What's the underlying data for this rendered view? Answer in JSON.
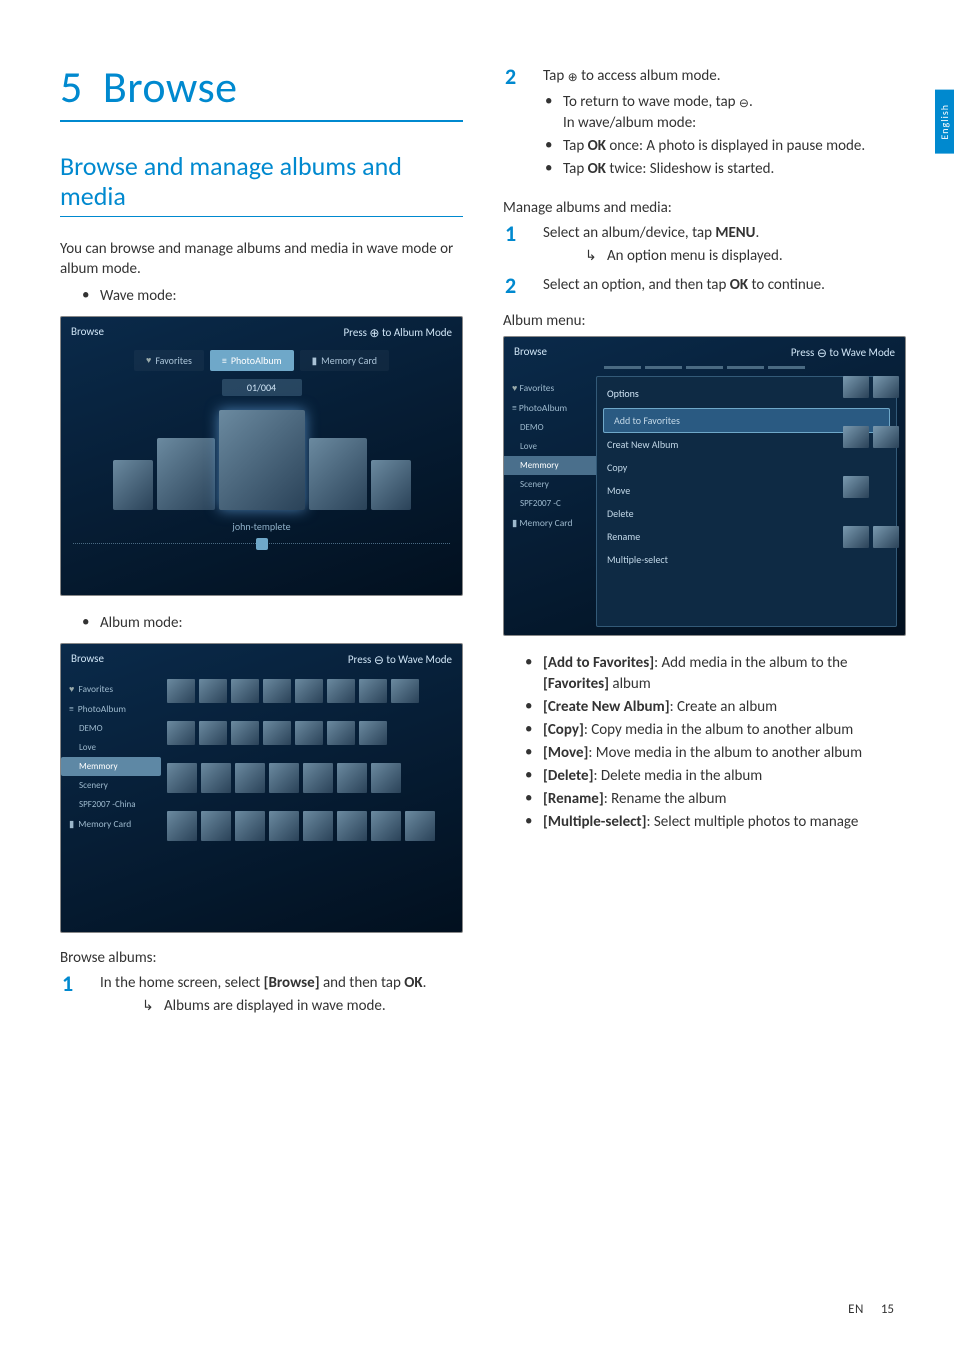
{
  "lang_tab": "English",
  "chapter": {
    "number": "5",
    "title": "Browse"
  },
  "section_title": "Browse and manage albums and media",
  "intro": "You can browse and manage albums and media in wave mode or album mode.",
  "modes": {
    "wave": "Wave mode:",
    "album": "Album mode:"
  },
  "wave_ss": {
    "title": "Browse",
    "hint_prefix": "Press ",
    "hint_suffix": " to Album Mode",
    "tabs": {
      "fav": "Favorites",
      "photo": "PhotoAlbum",
      "card": "Memory Card"
    },
    "counter": "01/004",
    "caption": "john-templete"
  },
  "album_ss": {
    "title": "Browse",
    "hint_prefix": "Press ",
    "hint_suffix": " to Wave Mode",
    "sidebar": {
      "fav": "Favorites",
      "photo": "PhotoAlbum",
      "demo": "DEMO",
      "love": "Love",
      "mem": "Memmory",
      "scenery": "Scenery",
      "spf": "SPF2007 -China",
      "card": "Memory Card"
    }
  },
  "browse_head": "Browse albums:",
  "step1": {
    "a": "In the home screen, select ",
    "b": "[Browse]",
    "c": " and then tap ",
    "d": "OK",
    "e": "."
  },
  "step1_res": "Albums are displayed in wave mode.",
  "step2": {
    "a": "Tap ",
    "b": " to access album mode."
  },
  "step2_b1": {
    "a": "To return to wave mode, tap ",
    "b": "."
  },
  "step2_line": "In wave/album mode:",
  "step2_b2": {
    "a": "Tap ",
    "b": "OK",
    "c": " once: A photo is displayed in pause mode."
  },
  "step2_b3": {
    "a": "Tap ",
    "b": "OK",
    "c": " twice: Slideshow is started."
  },
  "manage_head": "Manage albums and media:",
  "m1": {
    "a": "Select an album/device, tap ",
    "b": "MENU",
    "c": "."
  },
  "m1_res": "An option menu is displayed.",
  "m2": {
    "a": "Select an option, and then tap ",
    "b": "OK",
    "c": " to continue."
  },
  "menu_head": "Album menu:",
  "menu_ss": {
    "title": "Browse",
    "hint_prefix": "Press ",
    "hint_suffix": " to Wave Mode",
    "sidebar": {
      "fav": "Favorites",
      "photo": "PhotoAlbum",
      "demo": "DEMO",
      "love": "Love",
      "mem": "Memmory",
      "scenery": "Scenery",
      "spf": "SPF2007 -C",
      "card": "Memory Card"
    },
    "panel_head": "Options",
    "opts": {
      "addfav": "Add to Favorites",
      "create": "Creat New Album",
      "copy": "Copy",
      "move": "Move",
      "del": "Delete",
      "ren": "Rename",
      "multi": "Multiple-select"
    }
  },
  "defs": {
    "addfav": {
      "t": "[Add to Favorites]",
      "d": ": Add media in the album to the ",
      "e": "[Favorites]",
      "f": " album"
    },
    "create": {
      "t": "[Create New Album]",
      "d": ": Create an album"
    },
    "copy": {
      "t": "[Copy]",
      "d": ": Copy media in the album to another album"
    },
    "move": {
      "t": "[Move]",
      "d": ": Move media in the album to another album"
    },
    "del": {
      "t": "[Delete]",
      "d": ": Delete media in the album"
    },
    "ren": {
      "t": "[Rename]",
      "d": ": Rename the album"
    },
    "multi": {
      "t": "[Multiple-select]",
      "d": ": Select multiple photos to manage"
    }
  },
  "footer": {
    "lang": "EN",
    "page": "15"
  }
}
